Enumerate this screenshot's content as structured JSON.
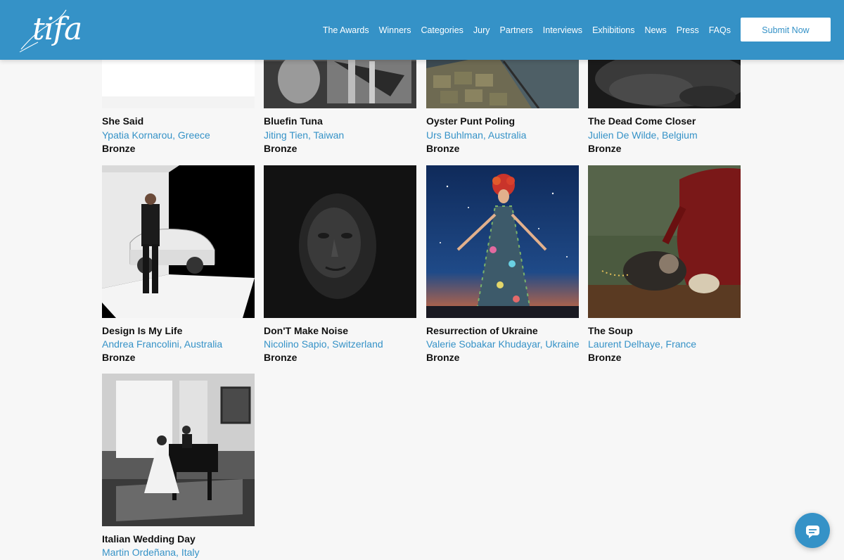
{
  "header": {
    "logo_text": "tifa",
    "nav": [
      "The Awards",
      "Winners",
      "Categories",
      "Jury",
      "Partners",
      "Interviews",
      "Exhibitions",
      "News",
      "Press",
      "FAQs"
    ],
    "submit_label": "Submit Now"
  },
  "colors": {
    "brand": "#3592c7",
    "link": "#3592c7",
    "text": "#111111",
    "background": "#f7f7f7"
  },
  "entries": [
    {
      "title": "She Said",
      "author": "Ypatia Kornarou, Greece",
      "award": "Bronze"
    },
    {
      "title": "Bluefin Tuna",
      "author": "Jiting Tien, Taiwan",
      "award": "Bronze"
    },
    {
      "title": "Oyster Punt Poling",
      "author": "Urs Buhlman, Australia",
      "award": "Bronze"
    },
    {
      "title": "The Dead Come Closer",
      "author": "Julien De Wilde, Belgium",
      "award": "Bronze"
    },
    {
      "title": "Design Is My Life",
      "author": "Andrea Francolini, Australia",
      "award": "Bronze"
    },
    {
      "title": "Don'T Make Noise",
      "author": "Nicolino Sapio, Switzerland",
      "award": "Bronze"
    },
    {
      "title": "Resurrection of Ukraine",
      "author": "Valerie Sobakar Khudayar, Ukraine",
      "award": "Bronze"
    },
    {
      "title": "The Soup",
      "author": "Laurent Delhaye, France",
      "award": "Bronze"
    },
    {
      "title": "Italian Wedding Day",
      "author": "Martin Ordeñana, Italy",
      "award": ""
    }
  ],
  "chat": {
    "icon": "chat-bubble-icon"
  }
}
